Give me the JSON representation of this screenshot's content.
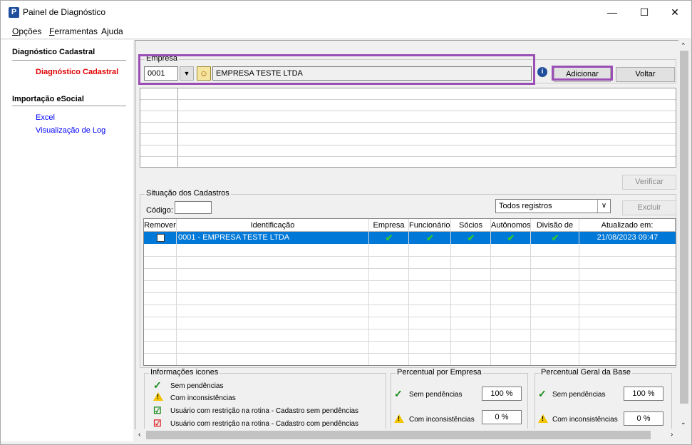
{
  "window": {
    "title": "Painel de Diagnóstico",
    "app_icon": "P"
  },
  "window_controls": {
    "minimize": "—",
    "maximize": "☐",
    "close": "✕"
  },
  "menu": {
    "items": [
      {
        "pre": "",
        "u": "O",
        "post": "pções"
      },
      {
        "pre": "",
        "u": "F",
        "post": "erramentas"
      },
      {
        "pre": "",
        "u": "",
        "post": "Ajuda"
      }
    ]
  },
  "sidebar": {
    "section1_title": "Diagnóstico Cadastral",
    "section1_link": "Diagnóstico Cadastral",
    "section2_title": "Importação eSocial",
    "section2_links": [
      "Excel",
      "Visualização de Log"
    ]
  },
  "empresa": {
    "group_title": "Empresa",
    "code": "0001",
    "name": "EMPRESA TESTE LTDA"
  },
  "buttons": {
    "adicionar": "Adicionar",
    "voltar": "Voltar",
    "verificar": "Verificar",
    "excluir": "Excluir"
  },
  "situacao": {
    "group_title": "Situação dos Cadastros",
    "codigo_label": "Código:",
    "filter_value": "Todos registros"
  },
  "table": {
    "headers": [
      "Remover",
      "Identificação",
      "Empresa",
      "Funcionários",
      "Sócios",
      "Autônomos",
      "Divisão de RH",
      "Atualizado em:"
    ],
    "rows": [
      {
        "identificacao": "0001 - EMPRESA TESTE LTDA",
        "atualizado": "21/08/2023 09:47"
      }
    ]
  },
  "legend": {
    "title": "Informações icones",
    "items": [
      "Sem pendências",
      "Com inconsistências",
      "Usuário com restrição na rotina -  Cadastro sem pendências",
      "Usuário com restrição na rotina - Cadastro com pendências"
    ]
  },
  "percent_empresa": {
    "title": "Percentual por Empresa",
    "sem_label": "Sem pendências",
    "sem_value": "100 %",
    "com_label": "Com inconsistências",
    "com_value": "0 %"
  },
  "percent_base": {
    "title": "Percentual Geral da Base",
    "sem_label": "Sem pendências",
    "sem_value": "100 %",
    "com_label": "Com inconsistências",
    "com_value": "0 %"
  },
  "colors": {
    "highlight": "#9b4fb5",
    "selection": "#0078d7",
    "link": "#0000ff",
    "active_link": "#e00000"
  }
}
